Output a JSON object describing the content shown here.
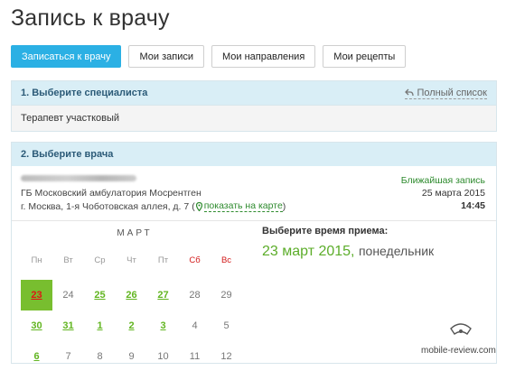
{
  "page": {
    "title": "Запись к врачу"
  },
  "tabs": [
    {
      "label": "Записаться к врачу",
      "active": true
    },
    {
      "label": "Мои записи",
      "active": false
    },
    {
      "label": "Мои направления",
      "active": false
    },
    {
      "label": "Мои рецепты",
      "active": false
    }
  ],
  "step1": {
    "heading": "1. Выберите специалиста",
    "full_list_label": "Полный список",
    "selected_specialist": "Терапевт участковый"
  },
  "step2": {
    "heading": "2. Выберите врача",
    "clinic": "ГБ Московский амбулатория Мосрентген",
    "address": "г. Москва, 1-я Чоботовская аллея, д. 7",
    "address_open": "(",
    "map_link": "показать на карте",
    "address_close": ")",
    "nearest_label": "Ближайшая запись",
    "nearest_date": "25 марта 2015",
    "nearest_time": "14:45"
  },
  "calendar": {
    "month": "МАРТ",
    "weekdays": [
      "Пн",
      "Вт",
      "Ср",
      "Чт",
      "Пт",
      "Сб",
      "Вс"
    ],
    "weekend_indices": [
      5,
      6
    ],
    "weeks": [
      [
        {
          "d": "23",
          "s": "selected"
        },
        {
          "d": "24",
          "s": "off"
        },
        {
          "d": "25",
          "s": "avail"
        },
        {
          "d": "26",
          "s": "avail"
        },
        {
          "d": "27",
          "s": "avail"
        },
        {
          "d": "28",
          "s": "off"
        },
        {
          "d": "29",
          "s": "off"
        }
      ],
      [
        {
          "d": "30",
          "s": "avail"
        },
        {
          "d": "31",
          "s": "avail"
        },
        {
          "d": "1",
          "s": "avail"
        },
        {
          "d": "2",
          "s": "avail"
        },
        {
          "d": "3",
          "s": "avail"
        },
        {
          "d": "4",
          "s": "off"
        },
        {
          "d": "5",
          "s": "off"
        }
      ],
      [
        {
          "d": "6",
          "s": "avail"
        },
        {
          "d": "7",
          "s": "off"
        },
        {
          "d": "8",
          "s": "off"
        },
        {
          "d": "9",
          "s": "off"
        },
        {
          "d": "10",
          "s": "off"
        },
        {
          "d": "11",
          "s": "off"
        },
        {
          "d": "12",
          "s": "off"
        }
      ]
    ]
  },
  "time_select": {
    "label": "Выберите время приема:",
    "date": "23 март 2015,",
    "weekday": "понедельник"
  },
  "watermark": {
    "text": "mobile-review.com"
  },
  "colors": {
    "accent": "#2bb0e4",
    "available": "#62b521",
    "selected_bg": "#78be2f",
    "weekend": "#d21a1a",
    "panel_head": "#d9eef6"
  }
}
